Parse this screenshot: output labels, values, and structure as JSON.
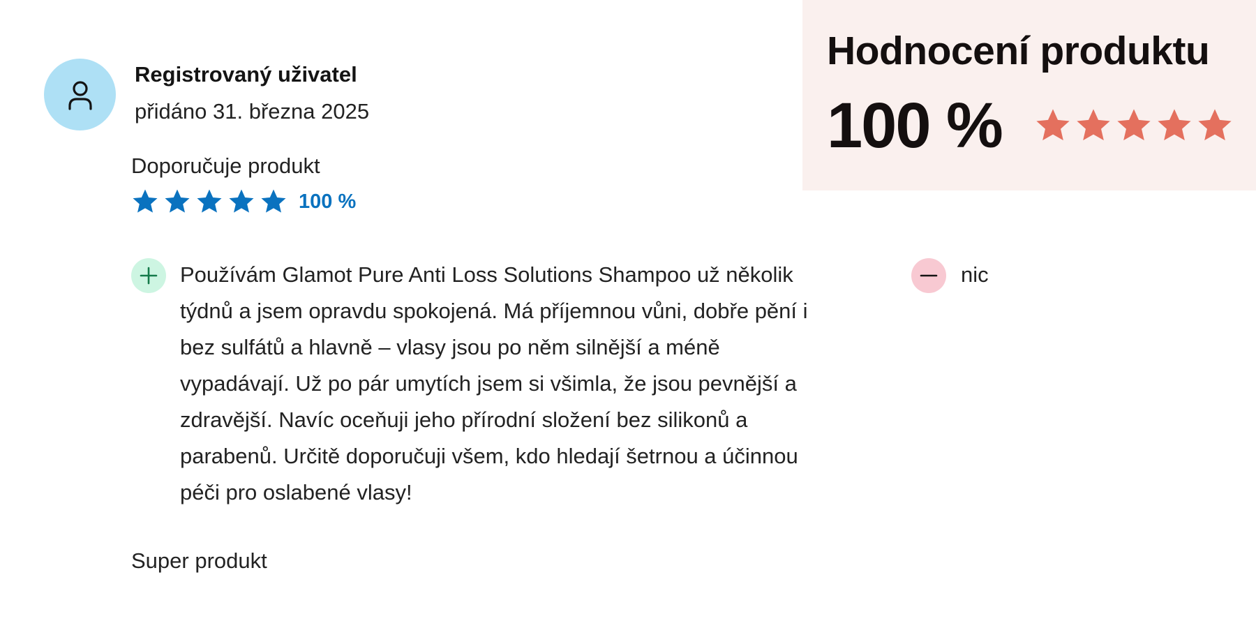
{
  "summary": {
    "title": "Hodnocení produktu",
    "score_label": "100 %",
    "stars_filled": 5,
    "stars_total": 5,
    "star_color": "#e4705e",
    "background_color": "#faf0ee"
  },
  "review": {
    "author": "Registrovaný uživatel",
    "date": "přidáno 31. března 2025",
    "avatar_icon": "user-icon",
    "recommendation": "Doporučuje produkt",
    "rating_label": "100 %",
    "rating_stars": 5,
    "rating_color": "#0a72bf",
    "pros_icon": "plus-icon",
    "pros": "Používám Glamot Pure Anti Loss Solutions Shampoo už několik týdnů a jsem opravdu spokojená. Má příjemnou vůni, dobře pění i bez sulfátů a hlavně – vlasy jsou po něm silnější a méně vypadávají. Už po pár umytích jsem si všimla, že jsou pevnější a zdravější. Navíc oceňuji jeho přírodní složení bez silikonů a parabenů. Určitě doporučuji všem, kdo hledají šetrnou a účinnou péči pro oslabené vlasy!",
    "cons_icon": "minus-icon",
    "cons": "nic",
    "title": "Super produkt"
  }
}
